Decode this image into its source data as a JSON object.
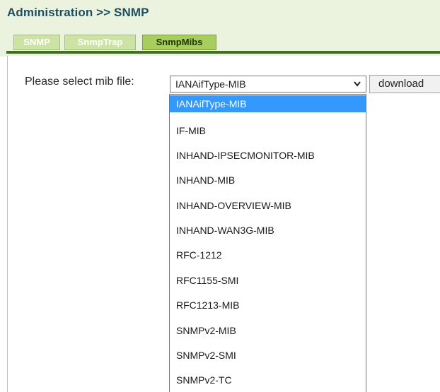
{
  "header": {
    "title": "Administration >> SNMP"
  },
  "tabs": [
    {
      "label": "SNMP",
      "active": false
    },
    {
      "label": "SnmpTrap",
      "active": false
    },
    {
      "label": "SnmpMibs",
      "active": true
    }
  ],
  "form": {
    "select_label": "Please select mib file:",
    "selected_value": "IANAifType-MIB",
    "download_label": "download",
    "options": [
      "IANAifType-MIB",
      "IF-MIB",
      "INHAND-IPSECMONITOR-MIB",
      "INHAND-MIB",
      "INHAND-OVERVIEW-MIB",
      "INHAND-WAN3G-MIB",
      "RFC-1212",
      "RFC1155-SMI",
      "RFC1213-MIB",
      "SNMPv2-MIB",
      "SNMPv2-SMI",
      "SNMPv2-TC"
    ]
  },
  "icons": {
    "dropdown_arrow": "chevron-down-icon"
  },
  "colors": {
    "header_bg": "#ebf3de",
    "accent_green": "#3d7020",
    "tab_active": "#a7cd5d",
    "tab_inactive": "#cde2a5",
    "selection_blue": "#3399ff",
    "title_text": "#1f4e60"
  }
}
